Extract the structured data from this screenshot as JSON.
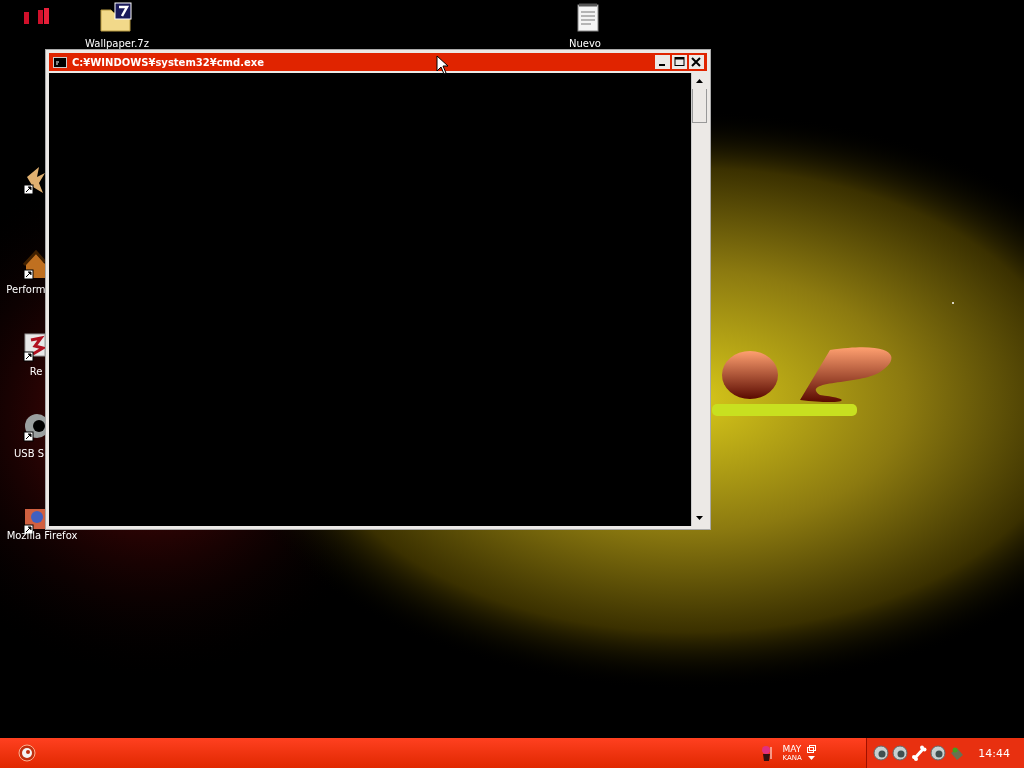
{
  "desktop_icons": [
    {
      "kind": "bars"
    },
    {
      "kind": "archive",
      "label": "Wallpaper.7z"
    },
    {
      "kind": "notepad",
      "label": "Nuevo"
    },
    {
      "kind": "bird"
    },
    {
      "kind": "house",
      "label": "Perform"
    },
    {
      "kind": "monitor",
      "label": "Re"
    },
    {
      "kind": "disc",
      "label": "USB S"
    },
    {
      "kind": "browser",
      "label": "Mozilla Firefox"
    }
  ],
  "window": {
    "title": "C:¥WINDOWS¥system32¥cmd.exe"
  },
  "taskbar": {
    "language": {
      "primary": "MAY",
      "secondary": "KANA"
    },
    "tray_icons": [
      {
        "kind": "orb"
      },
      {
        "kind": "orb"
      },
      {
        "kind": "bone"
      },
      {
        "kind": "orb"
      },
      {
        "kind": "gadget"
      }
    ],
    "clock": "14:44"
  }
}
